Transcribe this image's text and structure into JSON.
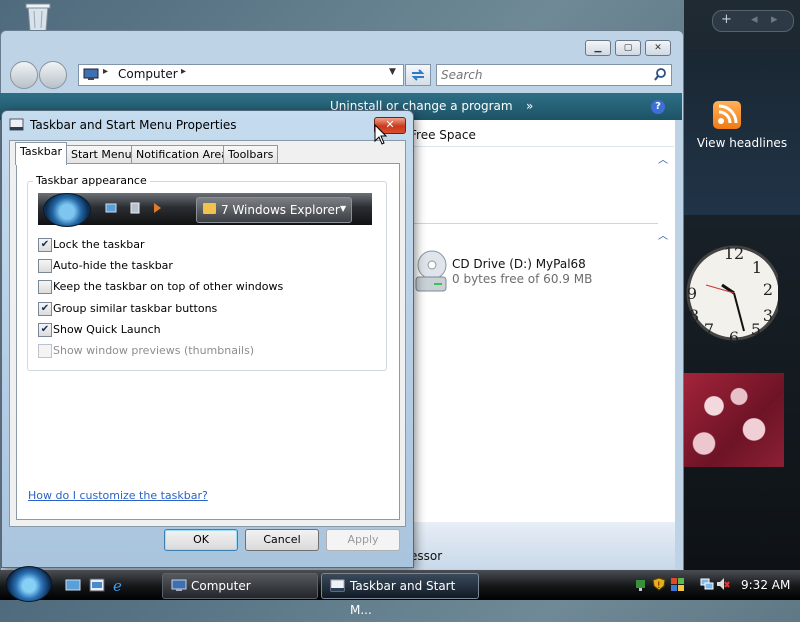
{
  "explorer": {
    "address": "Computer",
    "search_placeholder": "Search",
    "commands": {
      "uninstall": "Uninstall or change a program",
      "more": "»"
    },
    "column_free_space": "Free Space",
    "drive": {
      "name": "CD Drive (D:) MyPal68",
      "detail": "0 bytes free of 60.9 MB"
    },
    "status_partial": "essor"
  },
  "dialog": {
    "title": "Taskbar and Start Menu Properties",
    "close": "✕",
    "tabs": [
      "Taskbar",
      "Start Menu",
      "Notification Area",
      "Toolbars"
    ],
    "group_label": "Taskbar appearance",
    "preview_button": "7 Windows Explorer",
    "options": [
      {
        "label": "Lock the taskbar",
        "checked": true,
        "enabled": true
      },
      {
        "label": "Auto-hide the taskbar",
        "checked": false,
        "enabled": true
      },
      {
        "label": "Keep the taskbar on top of other windows",
        "checked": false,
        "enabled": true
      },
      {
        "label": "Group similar taskbar buttons",
        "checked": true,
        "enabled": true
      },
      {
        "label": "Show Quick Launch",
        "checked": true,
        "enabled": true
      },
      {
        "label": "Show window previews (thumbnails)",
        "checked": false,
        "enabled": false
      }
    ],
    "help_link": "How do I customize the taskbar?",
    "buttons": {
      "ok": "OK",
      "cancel": "Cancel",
      "apply": "Apply"
    }
  },
  "sidebar": {
    "controls": {
      "add": "+",
      "prev": "◂",
      "next": "▸"
    },
    "feed_label": "View headlines"
  },
  "taskbar": {
    "tasks": [
      "Computer",
      "Taskbar and Start M..."
    ],
    "time": "9:32 AM"
  },
  "colors": {
    "accent": "#1d5366",
    "link": "#2a62c9",
    "close_red": "#c9381c"
  },
  "icons": [
    "recycle-bin-icon",
    "back-arrow-icon",
    "forward-arrow-icon",
    "computer-icon",
    "refresh-icon",
    "search-icon",
    "help-icon",
    "cd-drive-icon",
    "rss-icon",
    "clock-icon",
    "start-orb-icon",
    "windows-explorer-icon",
    "ie-icon",
    "folder-icon",
    "network-icon",
    "volume-muted-icon",
    "shield-icon"
  ]
}
